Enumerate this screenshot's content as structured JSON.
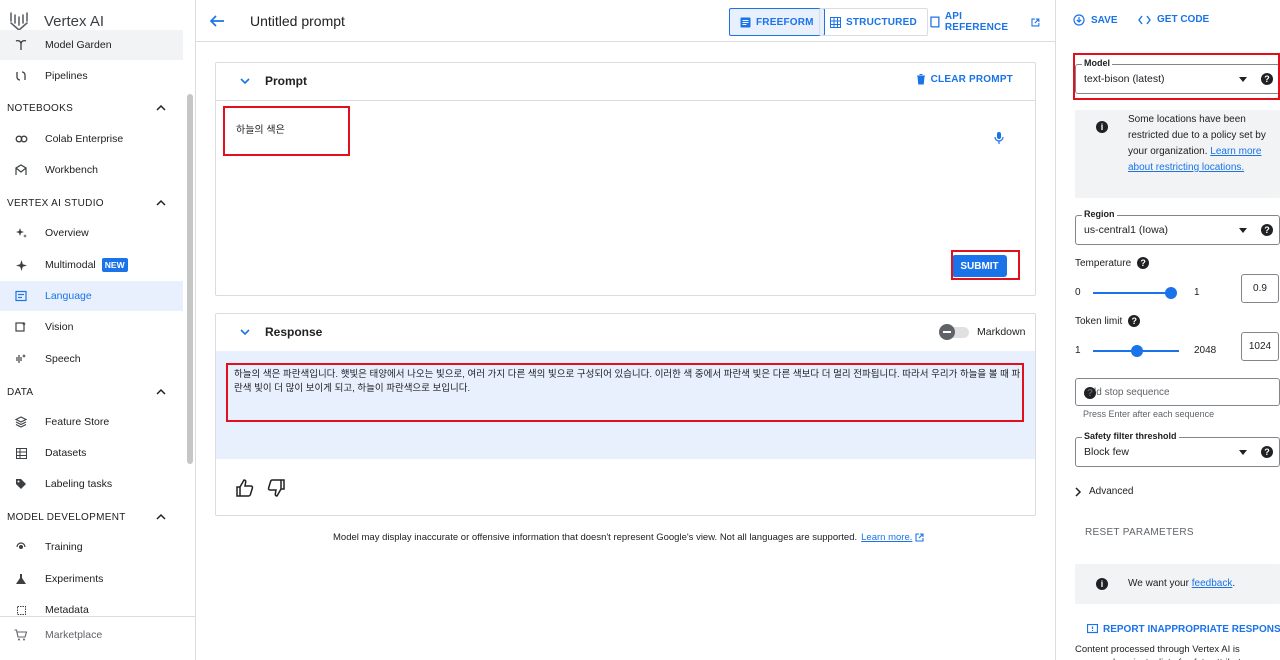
{
  "app": {
    "title": "Vertex AI"
  },
  "sidebar": {
    "items": [
      {
        "label": "Model Garden",
        "icon": "model-garden-icon"
      },
      {
        "label": "Pipelines",
        "icon": "pipelines-icon"
      }
    ],
    "sections": [
      {
        "label": "NOTEBOOKS",
        "items": [
          {
            "label": "Colab Enterprise"
          },
          {
            "label": "Workbench"
          }
        ]
      },
      {
        "label": "VERTEX AI STUDIO",
        "items": [
          {
            "label": "Overview"
          },
          {
            "label": "Multimodal",
            "badge": "NEW"
          },
          {
            "label": "Language"
          },
          {
            "label": "Vision"
          },
          {
            "label": "Speech"
          }
        ]
      },
      {
        "label": "DATA",
        "items": [
          {
            "label": "Feature Store"
          },
          {
            "label": "Datasets"
          },
          {
            "label": "Labeling tasks"
          }
        ]
      },
      {
        "label": "MODEL DEVELOPMENT",
        "items": [
          {
            "label": "Training"
          },
          {
            "label": "Experiments"
          },
          {
            "label": "Metadata"
          }
        ]
      }
    ],
    "active_item": "Language",
    "footer": {
      "label": "Marketplace"
    }
  },
  "header": {
    "title": "Untitled prompt",
    "modes": {
      "freeform": "FREEFORM",
      "structured": "STRUCTURED",
      "api_reference": "API REFERENCE"
    }
  },
  "prompt": {
    "title": "Prompt",
    "clear_label": "CLEAR PROMPT",
    "text": "하늘의 색은",
    "submit_label": "SUBMIT"
  },
  "response": {
    "title": "Response",
    "markdown_label": "Markdown",
    "markdown_enabled": false,
    "text": "하늘의 색은 파란색입니다. 햇빛은 태양에서 나오는 빛으로, 여러 가지 다른 색의 빛으로 구성되어 있습니다. 이러한 색 중에서 파란색 빛은 다른 색보다 더 멀리 전파됩니다. 따라서 우리가 하늘을 볼 때 파란색 빛이 더 많이 보이게 되고, 하늘이 파란색으로 보입니다."
  },
  "disclaimer": {
    "text": "Model may display inaccurate or offensive information that doesn't represent Google's view. Not all languages are supported.",
    "link": "Learn more."
  },
  "right_panel": {
    "save_label": "SAVE",
    "get_code_label": "GET CODE",
    "model": {
      "label": "Model",
      "value": "text-bison (latest)"
    },
    "location_notice": {
      "text": "Some locations have been restricted due to a policy set by your organization.",
      "link": "Learn more about restricting locations."
    },
    "region": {
      "label": "Region",
      "value": "us-central1 (Iowa)"
    },
    "temperature": {
      "label": "Temperature",
      "min": "0",
      "max": "1",
      "value": "0.9"
    },
    "token_limit": {
      "label": "Token limit",
      "min": "1",
      "max": "2048",
      "value": "1024"
    },
    "stop_sequence": {
      "placeholder": "Add stop sequence",
      "hint": "Press Enter after each sequence"
    },
    "safety": {
      "label": "Safety filter threshold",
      "value": "Block few"
    },
    "advanced_label": "Advanced",
    "reset_label": "RESET PARAMETERS",
    "feedback": {
      "text": "We want your",
      "link": "feedback",
      "suffix": "."
    },
    "report_label": "REPORT INAPPROPRIATE RESPONSES",
    "processed_text": "Content processed through Vertex AI is assessed against a list of safety attributes"
  },
  "colors": {
    "accent": "#1a73e8",
    "highlight_border": "#e0101e",
    "response_bg": "#e8f0fe"
  }
}
